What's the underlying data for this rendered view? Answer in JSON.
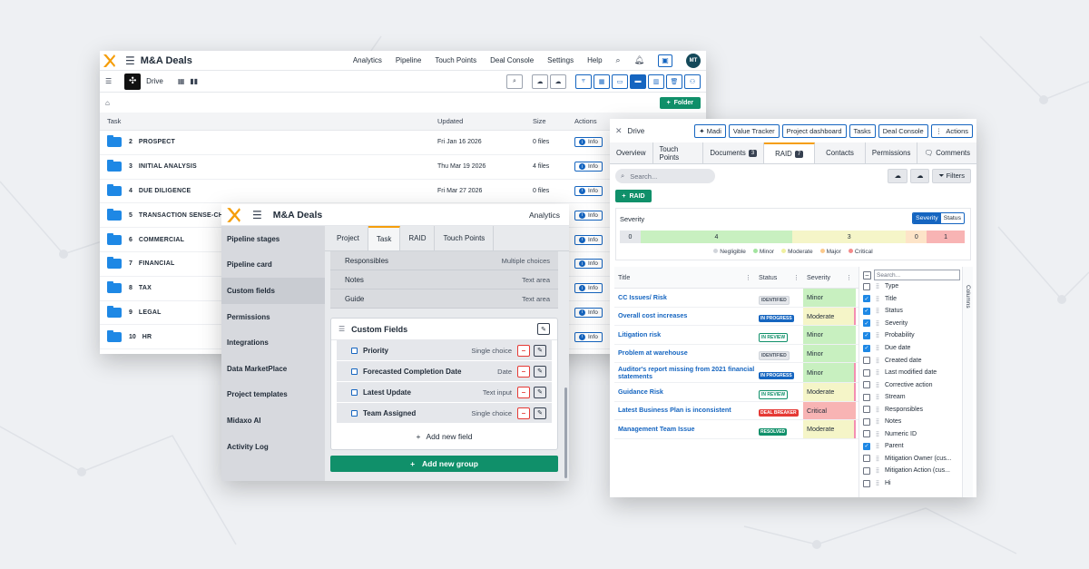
{
  "drive_window": {
    "app_title": "M&A Deals",
    "nav": [
      "Analytics",
      "Pipeline",
      "Touch Points",
      "Deal Console",
      "Settings",
      "Help"
    ],
    "avatar_initials": "MT",
    "drive_label": "Drive",
    "folder_button": "Folder",
    "columns": {
      "task": "Task",
      "updated": "Updated",
      "size": "Size",
      "actions": "Actions"
    },
    "info_label": "Info",
    "rows": [
      {
        "num": "2",
        "name": "PROSPECT",
        "updated": "Fri Jan 16 2026",
        "size": "0 files"
      },
      {
        "num": "3",
        "name": "INITIAL ANALYSIS",
        "updated": "Thu Mar 19 2026",
        "size": "4 files"
      },
      {
        "num": "4",
        "name": "DUE DILIGENCE",
        "updated": "Fri Mar 27 2026",
        "size": "0 files"
      },
      {
        "num": "5",
        "name": "TRANSACTION SENSE-CH",
        "updated": "",
        "size": ""
      },
      {
        "num": "6",
        "name": "COMMERCIAL",
        "updated": "",
        "size": ""
      },
      {
        "num": "7",
        "name": "FINANCIAL",
        "updated": "",
        "size": ""
      },
      {
        "num": "8",
        "name": "TAX",
        "updated": "",
        "size": ""
      },
      {
        "num": "9",
        "name": "LEGAL",
        "updated": "",
        "size": ""
      },
      {
        "num": "10",
        "name": "HR",
        "updated": "",
        "size": ""
      }
    ]
  },
  "settings_window": {
    "app_title": "M&A Deals",
    "analytics": "Analytics",
    "sidebar": [
      "Pipeline stages",
      "Pipeline card",
      "Custom fields",
      "Permissions",
      "Integrations",
      "Data MarketPlace",
      "Project templates",
      "Midaxo AI",
      "Activity Log"
    ],
    "tabs": [
      "Project",
      "Task",
      "RAID",
      "Touch Points"
    ],
    "fields": [
      {
        "name": "Responsibles",
        "type": "Multiple choices"
      },
      {
        "name": "Notes",
        "type": "Text area"
      },
      {
        "name": "Guide",
        "type": "Text area"
      }
    ],
    "custom_fields_title": "Custom Fields",
    "custom_fields": [
      {
        "name": "Priority",
        "type": "Single choice"
      },
      {
        "name": "Forecasted Completion Date",
        "type": "Date"
      },
      {
        "name": "Latest Update",
        "type": "Text input"
      },
      {
        "name": "Team Assigned",
        "type": "Single choice"
      }
    ],
    "add_field": "Add new field",
    "add_group": "Add new group"
  },
  "raid_window": {
    "drive_label": "Drive",
    "top_buttons": [
      "Madi",
      "Value Tracker",
      "Project dashboard",
      "Tasks",
      "Deal Console",
      "Actions"
    ],
    "tabs": [
      {
        "label": "Overview"
      },
      {
        "label": "Touch Points"
      },
      {
        "label": "Documents",
        "count": "3"
      },
      {
        "label": "RAID",
        "count": "7"
      },
      {
        "label": "Contacts"
      },
      {
        "label": "Permissions"
      },
      {
        "label": "Comments"
      }
    ],
    "search_placeholder": "Search...",
    "filters": "Filters",
    "add_raid": "RAID",
    "severity": {
      "title": "Severity",
      "toggle": [
        "Severity",
        "Status"
      ],
      "segments": [
        {
          "label": "Negligible",
          "value": 0,
          "color": "#e5e7eb"
        },
        {
          "label": "Minor",
          "value": 4,
          "color": "#c8f0c0"
        },
        {
          "label": "Moderate",
          "value": 3,
          "color": "#f5f5c8"
        },
        {
          "label": "Major",
          "value": 0,
          "color": "#fde4c8"
        },
        {
          "label": "Critical",
          "value": 1,
          "color": "#f8b4b4"
        }
      ],
      "legend_colors": [
        "#d1d5db",
        "#a3e4a0",
        "#f0f0a0",
        "#fbc98c",
        "#f48a8a"
      ]
    },
    "grid_columns": {
      "title": "Title",
      "status": "Status",
      "severity": "Severity"
    },
    "grid_rows": [
      {
        "title": "CC Issues/ Risk",
        "status": "IDENTIFIED",
        "status_kind": "ident",
        "severity": "Minor",
        "mark": false
      },
      {
        "title": "Overall cost increases",
        "status": "IN PROGRESS",
        "status_kind": "prog",
        "severity": "Moderate",
        "mark": true
      },
      {
        "title": "Litigation risk",
        "status": "IN REVIEW",
        "status_kind": "review",
        "severity": "Minor",
        "mark": false
      },
      {
        "title": "Problem at warehouse",
        "status": "IDENTIFIED",
        "status_kind": "ident",
        "severity": "Minor",
        "mark": false
      },
      {
        "title": "Auditor's report missing from 2021 financial statements",
        "status": "IN PROGRESS",
        "status_kind": "prog",
        "severity": "Minor",
        "mark": true
      },
      {
        "title": "Guidance Risk",
        "status": "IN REVIEW",
        "status_kind": "review",
        "severity": "Moderate",
        "mark": true
      },
      {
        "title": "Latest Business Plan is inconsistent",
        "status": "DEAL BREAKER",
        "status_kind": "deal",
        "severity": "Critical",
        "mark": false
      },
      {
        "title": "Management Team Issue",
        "status": "RESOLVED",
        "status_kind": "resolved",
        "severity": "Moderate",
        "mark": true
      }
    ],
    "columns_search_placeholder": "Search...",
    "columns_tab": "Columns",
    "column_options": [
      {
        "label": "Type",
        "checked": false
      },
      {
        "label": "Title",
        "checked": true
      },
      {
        "label": "Status",
        "checked": true
      },
      {
        "label": "Severity",
        "checked": true
      },
      {
        "label": "Probability",
        "checked": true
      },
      {
        "label": "Due date",
        "checked": true
      },
      {
        "label": "Created date",
        "checked": false
      },
      {
        "label": "Last modified date",
        "checked": false
      },
      {
        "label": "Corrective action",
        "checked": false
      },
      {
        "label": "Stream",
        "checked": false
      },
      {
        "label": "Responsibles",
        "checked": false
      },
      {
        "label": "Notes",
        "checked": false
      },
      {
        "label": "Numeric ID",
        "checked": false
      },
      {
        "label": "Parent",
        "checked": true
      },
      {
        "label": "Mitigation Owner (cus...",
        "checked": false
      },
      {
        "label": "Mitigation Action (cus...",
        "checked": false
      },
      {
        "label": "Hi",
        "checked": false
      }
    ],
    "severity_colors": {
      "Minor": "#c8f0c0",
      "Moderate": "#f5f5c8",
      "Critical": "#f8b4b4"
    }
  }
}
